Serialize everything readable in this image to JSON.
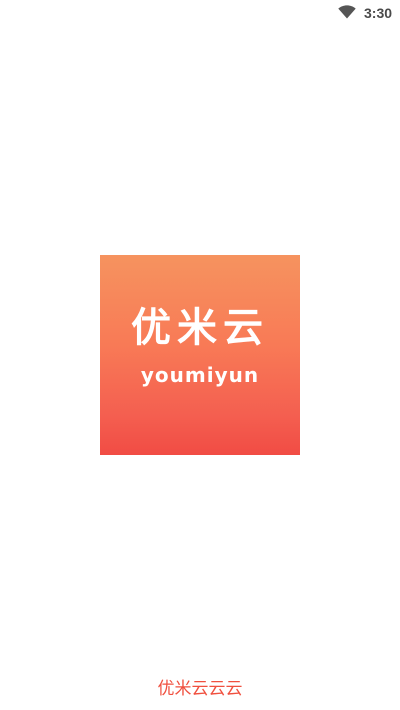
{
  "status_bar": {
    "time": "3:30",
    "wifi_icon": "wifi-icon"
  },
  "logo": {
    "title_cn": "优米云",
    "title_en": "youmiyun",
    "gradient_top": "#f6935f",
    "gradient_bottom": "#f14c44"
  },
  "footer": {
    "brand": "优米云云云"
  }
}
